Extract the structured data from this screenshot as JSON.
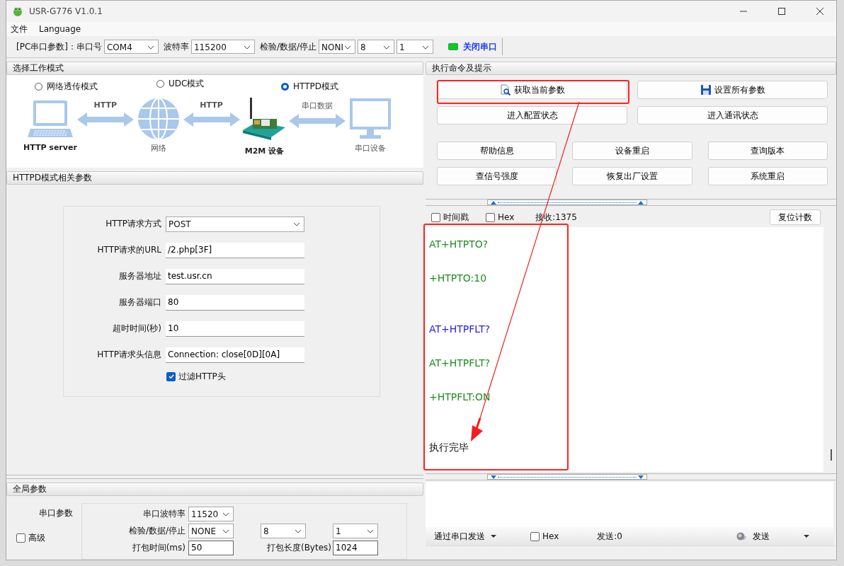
{
  "window": {
    "title": "USR-G776 V1.0.1"
  },
  "menu": [
    "文件",
    "Language"
  ],
  "toolbar": {
    "port_label": "[PC串口参数]：串口号",
    "port": "COM4",
    "baud_label": "波特率",
    "baud": "115200",
    "parity_label": "检验/数据/停止",
    "parity": "NONI",
    "data_bits": "8",
    "stop_bits": "1",
    "port_button": {
      "label": "关闭串口",
      "on": true
    }
  },
  "mode_panel": {
    "title": "选择工作模式",
    "modes": [
      {
        "label": "网络透传模式",
        "selected": false
      },
      {
        "label": "UDC模式",
        "selected": false
      },
      {
        "label": "HTTPD模式",
        "selected": true
      }
    ],
    "nodes": [
      {
        "label": "HTTP server",
        "kind": "laptop"
      },
      {
        "label": "网络",
        "kind": "globe"
      },
      {
        "label": "M2M 设备",
        "kind": "device"
      },
      {
        "label": "串口设备",
        "kind": "monitor"
      }
    ],
    "links": [
      "HTTP",
      "HTTP",
      "串口数据"
    ]
  },
  "httpd_panel": {
    "title": "HTTPD模式相关参数",
    "fields": [
      {
        "label": "HTTP请求方式",
        "value": "POST",
        "kind": "select"
      },
      {
        "label": "HTTP请求的URL",
        "value": "/2.php[3F]",
        "kind": "text"
      },
      {
        "label": "服务器地址",
        "value": "test.usr.cn",
        "kind": "text"
      },
      {
        "label": "服务器端口",
        "value": "80",
        "kind": "text"
      },
      {
        "label": "超时时间(秒)",
        "value": "10",
        "kind": "text"
      },
      {
        "label": "HTTP请求头信息",
        "value": "Connection: close[0D][0A]",
        "kind": "text"
      }
    ],
    "filter": {
      "label": "过滤HTTP头",
      "checked": true
    }
  },
  "global_panel": {
    "title": "全局参数",
    "group_label": "串口参数",
    "baud_label": "串口波特率",
    "baud": "11520",
    "parity_label": "检验/数据/停止",
    "parity": "NONE",
    "data_bits": "8",
    "stop_bits": "1",
    "pack_time_label": "打包时间(ms)",
    "pack_time": "50",
    "pack_len_label": "打包长度(Bytes)",
    "pack_len": "1024",
    "advanced": {
      "label": "高级",
      "checked": false
    }
  },
  "command_panel": {
    "title": "执行命令及提示",
    "main_buttons": [
      {
        "label": "获取当前参数",
        "kind": "search"
      },
      {
        "label": "设置所有参数",
        "kind": "save"
      },
      {
        "label": "进入配置状态",
        "kind": "plain"
      },
      {
        "label": "进入通讯状态",
        "kind": "plain"
      }
    ],
    "tool_buttons": [
      "帮助信息",
      "设备重启",
      "查询版本",
      "查信号强度",
      "恢复出厂设置",
      "系统重启"
    ]
  },
  "receive": {
    "timestamp": {
      "label": "时间戳",
      "checked": false
    },
    "hex": {
      "label": "Hex",
      "checked": false
    },
    "count": "接收:1375",
    "reset_button": "复位计数",
    "lines": [
      {
        "text": "AT+HTPTO?",
        "color": "#1e8c1e"
      },
      {
        "text": "+HTPTO:10",
        "color": "#1e8c1e"
      },
      {
        "text": "AT+HTPFLT?",
        "color": "#2222ee"
      },
      {
        "text": "AT+HTPFLT?",
        "color": "#1e8c1e"
      },
      {
        "text": "+HTPFLT:ON",
        "color": "#1e8c1e"
      },
      {
        "text": "执行完毕"
      }
    ]
  },
  "send": {
    "mode": "通过串口发送",
    "hex": {
      "label": "Hex",
      "checked": false
    },
    "count": "发送:0",
    "send_button": "发送"
  }
}
